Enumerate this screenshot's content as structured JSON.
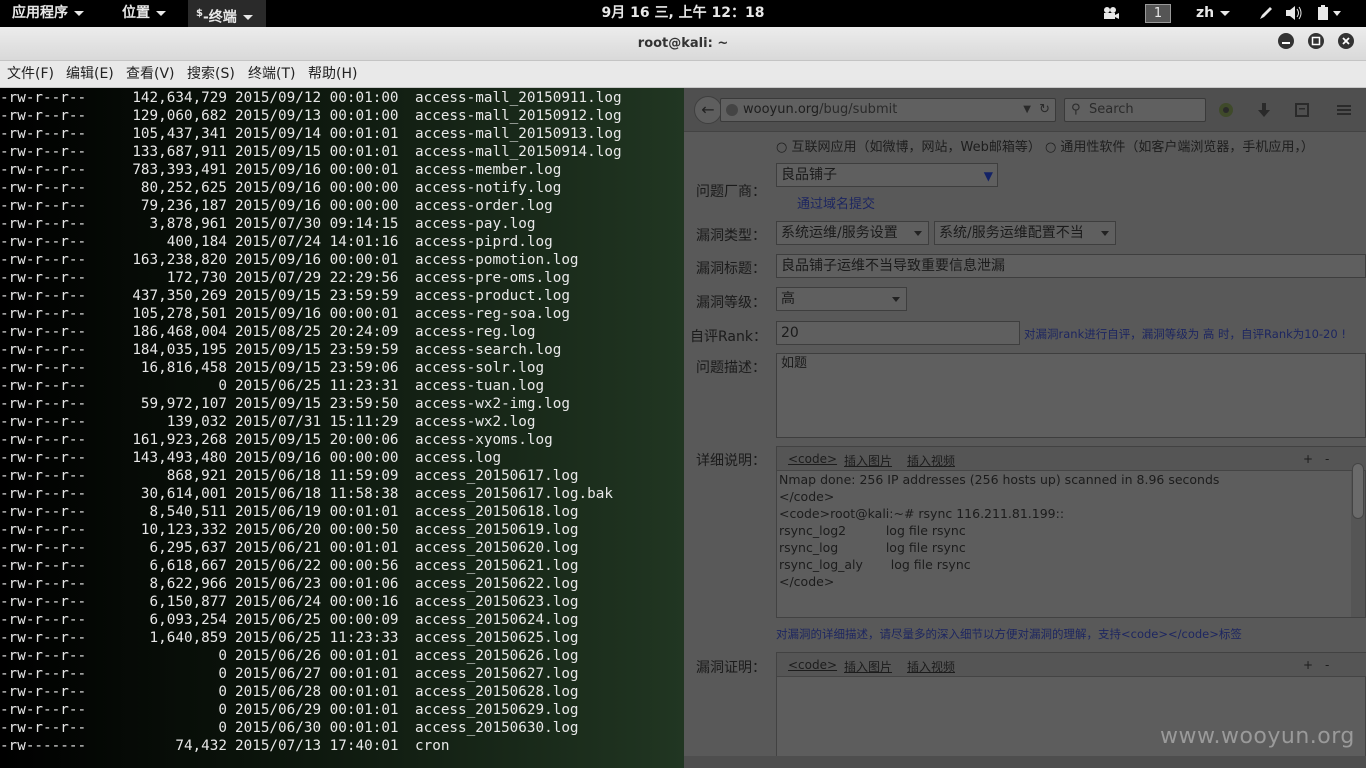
{
  "topbar": {
    "applications": "应用程序",
    "places": "位置",
    "terminal_task_prefix": "$",
    "terminal_task": "-终端",
    "clock": "9月 16 三, 上午 12：18",
    "workspace": "1",
    "lang": "zh",
    "video_icon": "video-camera-icon",
    "pen_icon": "pen-icon",
    "volume_icon": "volume-icon",
    "battery_icon": "battery-icon"
  },
  "window": {
    "title": "root@kali: ~",
    "minimize_icon": "minimize-icon",
    "maximize_icon": "maximize-icon",
    "close_icon": "close-icon"
  },
  "menubar": {
    "file": "文件(F)",
    "edit": "编辑(E)",
    "view": "查看(V)",
    "search": "搜索(S)",
    "terminal": "终端(T)",
    "help": "帮助(H)"
  },
  "terminal_rows": [
    {
      "perm": "-rw-r--r--",
      "size": "142,634,729",
      "date": "2015/09/12 00:01:00",
      "name": "access-mall_20150911.log"
    },
    {
      "perm": "-rw-r--r--",
      "size": "129,060,682",
      "date": "2015/09/13 00:01:00",
      "name": "access-mall_20150912.log"
    },
    {
      "perm": "-rw-r--r--",
      "size": "105,437,341",
      "date": "2015/09/14 00:01:01",
      "name": "access-mall_20150913.log"
    },
    {
      "perm": "-rw-r--r--",
      "size": "133,687,911",
      "date": "2015/09/15 00:01:01",
      "name": "access-mall_20150914.log"
    },
    {
      "perm": "-rw-r--r--",
      "size": "783,393,491",
      "date": "2015/09/16 00:00:01",
      "name": "access-member.log"
    },
    {
      "perm": "-rw-r--r--",
      "size": "80,252,625",
      "date": "2015/09/16 00:00:00",
      "name": "access-notify.log"
    },
    {
      "perm": "-rw-r--r--",
      "size": "79,236,187",
      "date": "2015/09/16 00:00:00",
      "name": "access-order.log"
    },
    {
      "perm": "-rw-r--r--",
      "size": "3,878,961",
      "date": "2015/07/30 09:14:15",
      "name": "access-pay.log"
    },
    {
      "perm": "-rw-r--r--",
      "size": "400,184",
      "date": "2015/07/24 14:01:16",
      "name": "access-piprd.log"
    },
    {
      "perm": "-rw-r--r--",
      "size": "163,238,820",
      "date": "2015/09/16 00:00:01",
      "name": "access-pomotion.log"
    },
    {
      "perm": "-rw-r--r--",
      "size": "172,730",
      "date": "2015/07/29 22:29:56",
      "name": "access-pre-oms.log"
    },
    {
      "perm": "-rw-r--r--",
      "size": "437,350,269",
      "date": "2015/09/15 23:59:59",
      "name": "access-product.log"
    },
    {
      "perm": "-rw-r--r--",
      "size": "105,278,501",
      "date": "2015/09/16 00:00:01",
      "name": "access-reg-soa.log"
    },
    {
      "perm": "-rw-r--r--",
      "size": "186,468,004",
      "date": "2015/08/25 20:24:09",
      "name": "access-reg.log"
    },
    {
      "perm": "-rw-r--r--",
      "size": "184,035,195",
      "date": "2015/09/15 23:59:59",
      "name": "access-search.log"
    },
    {
      "perm": "-rw-r--r--",
      "size": "16,816,458",
      "date": "2015/09/15 23:59:06",
      "name": "access-solr.log"
    },
    {
      "perm": "-rw-r--r--",
      "size": "0",
      "date": "2015/06/25 11:23:31",
      "name": "access-tuan.log"
    },
    {
      "perm": "-rw-r--r--",
      "size": "59,972,107",
      "date": "2015/09/15 23:59:50",
      "name": "access-wx2-img.log"
    },
    {
      "perm": "-rw-r--r--",
      "size": "139,032",
      "date": "2015/07/31 15:11:29",
      "name": "access-wx2.log"
    },
    {
      "perm": "-rw-r--r--",
      "size": "161,923,268",
      "date": "2015/09/15 20:00:06",
      "name": "access-xyoms.log"
    },
    {
      "perm": "-rw-r--r--",
      "size": "143,493,480",
      "date": "2015/09/16 00:00:00",
      "name": "access.log"
    },
    {
      "perm": "-rw-r--r--",
      "size": "868,921",
      "date": "2015/06/18 11:59:09",
      "name": "access_20150617.log"
    },
    {
      "perm": "-rw-r--r--",
      "size": "30,614,001",
      "date": "2015/06/18 11:58:38",
      "name": "access_20150617.log.bak"
    },
    {
      "perm": "-rw-r--r--",
      "size": "8,540,511",
      "date": "2015/06/19 00:01:01",
      "name": "access_20150618.log"
    },
    {
      "perm": "-rw-r--r--",
      "size": "10,123,332",
      "date": "2015/06/20 00:00:50",
      "name": "access_20150619.log"
    },
    {
      "perm": "-rw-r--r--",
      "size": "6,295,637",
      "date": "2015/06/21 00:01:01",
      "name": "access_20150620.log"
    },
    {
      "perm": "-rw-r--r--",
      "size": "6,618,667",
      "date": "2015/06/22 00:00:56",
      "name": "access_20150621.log"
    },
    {
      "perm": "-rw-r--r--",
      "size": "8,622,966",
      "date": "2015/06/23 00:01:06",
      "name": "access_20150622.log"
    },
    {
      "perm": "-rw-r--r--",
      "size": "6,150,877",
      "date": "2015/06/24 00:00:16",
      "name": "access_20150623.log"
    },
    {
      "perm": "-rw-r--r--",
      "size": "6,093,254",
      "date": "2015/06/25 00:00:09",
      "name": "access_20150624.log"
    },
    {
      "perm": "-rw-r--r--",
      "size": "1,640,859",
      "date": "2015/06/25 11:23:33",
      "name": "access_20150625.log"
    },
    {
      "perm": "-rw-r--r--",
      "size": "0",
      "date": "2015/06/26 00:01:01",
      "name": "access_20150626.log"
    },
    {
      "perm": "-rw-r--r--",
      "size": "0",
      "date": "2015/06/27 00:01:01",
      "name": "access_20150627.log"
    },
    {
      "perm": "-rw-r--r--",
      "size": "0",
      "date": "2015/06/28 00:01:01",
      "name": "access_20150628.log"
    },
    {
      "perm": "-rw-r--r--",
      "size": "0",
      "date": "2015/06/29 00:01:01",
      "name": "access_20150629.log"
    },
    {
      "perm": "-rw-r--r--",
      "size": "0",
      "date": "2015/06/30 00:01:01",
      "name": "access_20150630.log"
    },
    {
      "perm": "-rw-------",
      "size": "74,432",
      "date": "2015/07/13 17:40:01",
      "name": "cron"
    }
  ],
  "browser": {
    "url_host": "wooyun.org",
    "url_path": "/bug/submit",
    "search_placeholder": "Search",
    "back_icon": "back-arrow-icon",
    "refresh_icon": "refresh-icon",
    "download_icon": "download-icon",
    "addon_icon": "addon-icon",
    "reader_icon": "reader-icon",
    "menu_icon": "hamburger-menu-icon",
    "top_cut_text": "○ 互联网应用（如微博，网站，Web邮箱等） ○ 通用性软件（如客户端浏览器，手机应用，）",
    "vendor_label": "问题厂商：",
    "vendor_value": "良品铺子",
    "domain_submit_link": "通过域名提交",
    "vuln_type_label": "漏洞类型：",
    "vuln_type_1": "系统运维/服务设置",
    "vuln_type_2": "系统/服务运维配置不当",
    "vuln_title_label": "漏洞标题：",
    "vuln_title_value": "良品铺子运维不当导致重要信息泄漏",
    "level_label": "漏洞等级：",
    "level_value": "高",
    "rank_label": "自评Rank：",
    "rank_value": "20",
    "rank_hint": "对漏洞rank进行自评，漏洞等级为 高 时，自评Rank为10-20 !",
    "desc_label": "问题描述：",
    "desc_value": "如题",
    "detail_label": "详细说明：",
    "tool_code": "<code>",
    "tool_image": "插入图片",
    "tool_video": "插入视频",
    "tool_plus": "+",
    "tool_minus": "-",
    "detail_lines": [
      "Nmap done: 256 IP addresses (256 hosts up) scanned in 8.96 seconds",
      "</code>",
      "<code>root@kali:~# rsync 116.211.81.199::",
      "rsync_log2          log file rsync",
      "rsync_log            log file rsync",
      "rsync_log_aly       log file rsync",
      "</code>"
    ],
    "detail_hint": "对漏洞的详细描述，请尽量多的深入细节以方便对漏洞的理解，支持<code></code>标签",
    "proof_label": "漏洞证明："
  },
  "watermark": "www.wooyun.org"
}
